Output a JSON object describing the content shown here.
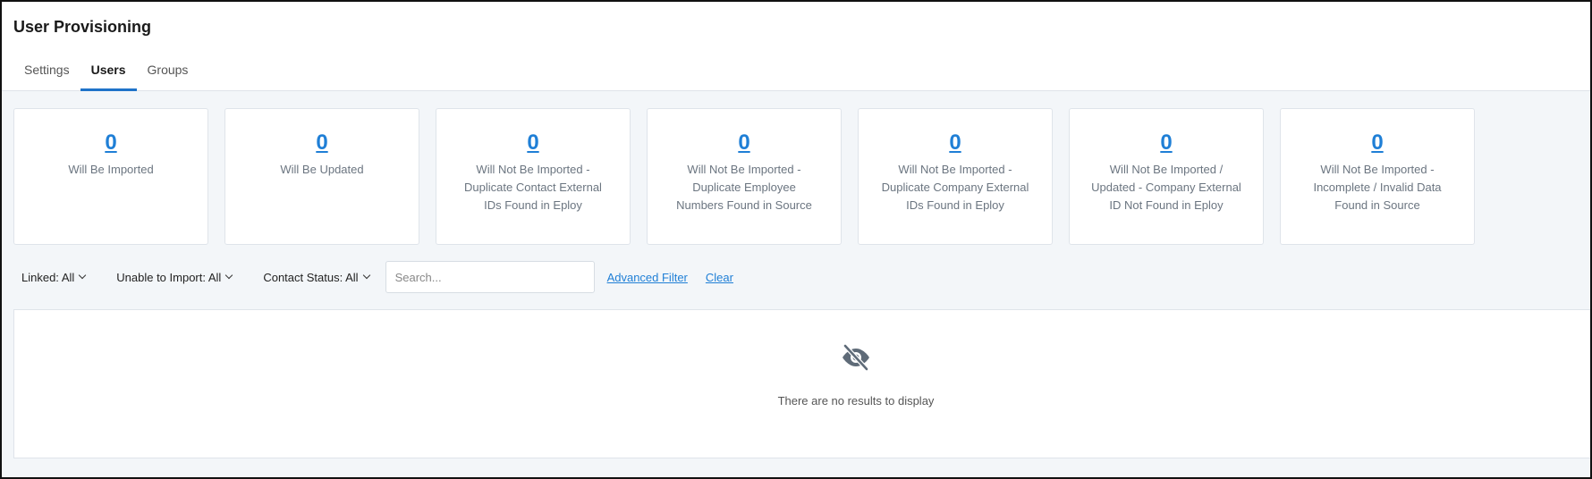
{
  "page": {
    "title": "User Provisioning"
  },
  "tabs": [
    {
      "label": "Settings",
      "active": false
    },
    {
      "label": "Users",
      "active": true
    },
    {
      "label": "Groups",
      "active": false
    }
  ],
  "cards": [
    {
      "count": "0",
      "label": "Will Be Imported"
    },
    {
      "count": "0",
      "label": "Will Be Updated"
    },
    {
      "count": "0",
      "label": "Will Not Be Imported - Duplicate Contact External IDs Found in Eploy"
    },
    {
      "count": "0",
      "label": "Will Not Be Imported - Duplicate Employee Numbers Found in Source"
    },
    {
      "count": "0",
      "label": "Will Not Be Imported - Duplicate Company External IDs Found in Eploy"
    },
    {
      "count": "0",
      "label": "Will Not Be Imported / Updated - Company External ID Not Found in Eploy"
    },
    {
      "count": "0",
      "label": "Will Not Be Imported - Incomplete / Invalid Data Found in Source"
    }
  ],
  "filters": {
    "linked": "Linked: All",
    "unable_to_import": "Unable to Import: All",
    "contact_status": "Contact Status: All",
    "search_placeholder": "Search...",
    "search_value": "",
    "advanced_filter": "Advanced Filter",
    "clear": "Clear"
  },
  "results": {
    "empty_message": "There are no results to display",
    "empty_icon": "eye-slash-icon"
  },
  "colors": {
    "accent": "#1f73c9",
    "link": "#1f7fd6",
    "background": "#f3f6f9"
  }
}
